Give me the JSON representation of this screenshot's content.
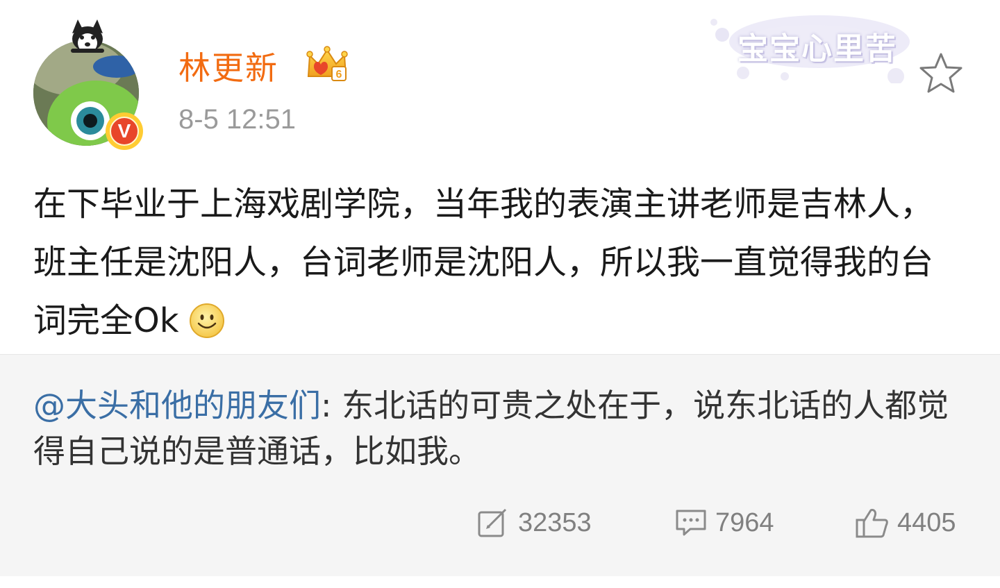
{
  "user": {
    "name": "林更新",
    "verified_mark": "V",
    "vip_level": "6"
  },
  "post": {
    "timestamp": "8-5 12:51",
    "text": "在下毕业于上海戏剧学院，当年我的表演主讲老师是吉林人，班主任是沈阳人，台词老师是沈阳人，所以我一直觉得我的台词完全Ok",
    "emoji": "smile-emoji"
  },
  "sticker": {
    "text": "宝宝心里苦"
  },
  "retweet": {
    "mention": "@大头和他的朋友们",
    "separator": ": ",
    "text": "东北话的可贵之处在于，说东北话的人都觉得自己说的是普通话，比如我。"
  },
  "actions": {
    "reposts": "32353",
    "comments": "7964",
    "likes": "4405"
  },
  "colors": {
    "username": "#f26b11",
    "mention": "#3a6ea5",
    "timestamp": "#9a9a9a",
    "retweet_bg": "#f5f5f5",
    "action_gray": "#808080"
  },
  "icons": {
    "star": "star-outline-icon",
    "repost": "repost-edit-icon",
    "comment": "comment-bubble-icon",
    "like": "thumbs-up-icon",
    "vip": "crown-vip-icon"
  }
}
